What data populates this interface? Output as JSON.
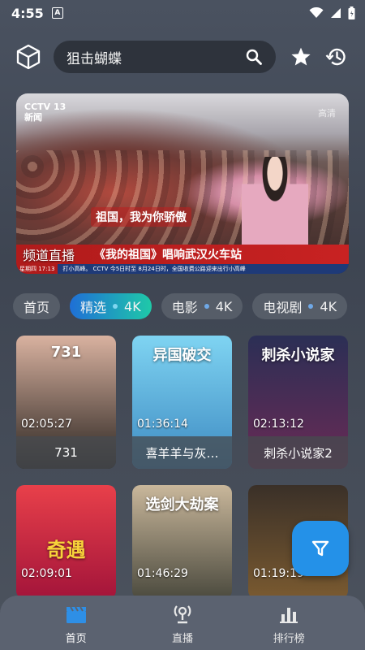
{
  "status": {
    "time": "4:55",
    "app_badge": "A"
  },
  "search": {
    "query": "狙击蝴蝶"
  },
  "banner": {
    "channel_label": "频道直播",
    "logo_text": "CCTV 13",
    "logo_sub": "新闻",
    "hd_mark": "高清",
    "slogan": "祖国，我为你骄傲",
    "headline": "《我的祖国》唱响武汉火车站",
    "ticker_date": "星期四 17:13",
    "ticker_text": "打小高峰。 CCTV 今5日时至 8月24日时，全国收费公路迎来出行小高峰"
  },
  "tabs": [
    {
      "label": "首页",
      "badge": ""
    },
    {
      "label": "精选",
      "badge": "4K"
    },
    {
      "label": "电影",
      "badge": "4K"
    },
    {
      "label": "电视剧",
      "badge": "4K"
    }
  ],
  "cards": [
    {
      "title": "731",
      "duration": "02:05:27",
      "poster_top": "#d9b2a0",
      "poster_bottom": "#2a2420",
      "poster_text": "731"
    },
    {
      "title": "喜羊羊与灰…",
      "duration": "01:36:14",
      "poster_top": "#7fd4f2",
      "poster_bottom": "#3d8ac2",
      "poster_text": "异国破交"
    },
    {
      "title": "刺杀小说家2",
      "duration": "02:13:12",
      "poster_top": "#2b2f55",
      "poster_bottom": "#6a2a55",
      "poster_text": "刺杀小说家"
    },
    {
      "title": "",
      "duration": "02:09:01",
      "poster_top": "#e8404a",
      "poster_bottom": "#a3143a",
      "poster_text": "奇遇"
    },
    {
      "title": "",
      "duration": "01:46:29",
      "poster_top": "#c9b79b",
      "poster_bottom": "#4b4a3e",
      "poster_text": "选剑大劫案"
    },
    {
      "title": "",
      "duration": "01:19:19",
      "poster_top": "#3a3028",
      "poster_bottom": "#7a5a30",
      "poster_text": ""
    }
  ],
  "nav": [
    {
      "label": "首页",
      "icon": "clapperboard-icon"
    },
    {
      "label": "直播",
      "icon": "broadcast-icon"
    },
    {
      "label": "排行榜",
      "icon": "bar-chart-icon"
    }
  ],
  "colors": {
    "accent": "#2491e8",
    "tab_active_start": "#1f6fd6",
    "tab_active_end": "#1fc9a8"
  }
}
